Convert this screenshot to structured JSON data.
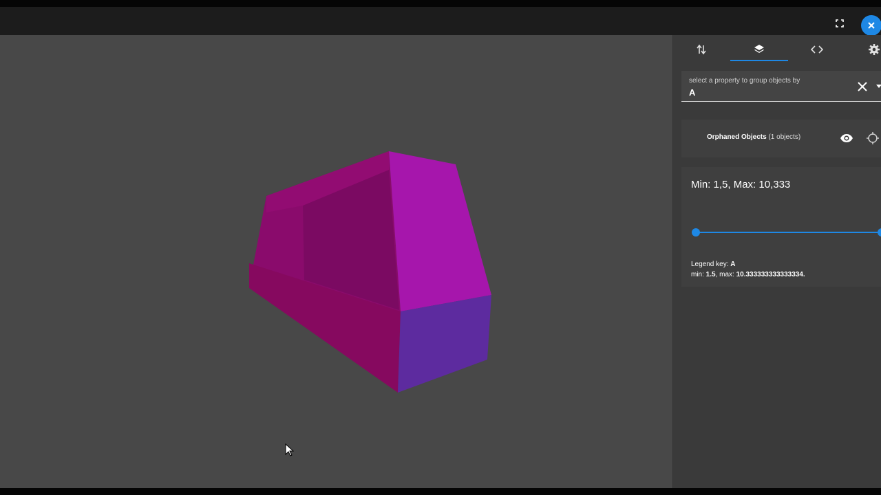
{
  "window": {
    "fullscreen_icon": "fullscreen-icon",
    "close_icon": "close-icon",
    "accent_color": "#1e88e5"
  },
  "viewport": {
    "background_color": "#484848",
    "object_colors": [
      "#a616ac",
      "#8a0b6c",
      "#5d2b9f"
    ]
  },
  "panel": {
    "tabs": [
      {
        "icon": "sort-arrows-icon",
        "active": false
      },
      {
        "icon": "layers-icon",
        "active": true
      },
      {
        "icon": "code-icon",
        "active": false
      },
      {
        "icon": "gear-icon",
        "active": false
      }
    ],
    "group_by": {
      "label": "select a property to group objects by",
      "value": "A"
    },
    "orphaned": {
      "name": "Orphaned Objects",
      "count": "(1 objects)"
    },
    "legend": {
      "min_label": "Min: ",
      "min_value": "1,5",
      "max_label": ", Max: ",
      "max_value": "10,333",
      "range_min": 1.5,
      "range_max": 10.333333333333334,
      "key_prefix": "Legend key: ",
      "key_value": "A",
      "min_text_label": "min: ",
      "min_text_value": "1.5",
      "max_text_label": ", max: ",
      "max_text_value": "10.333333333333334."
    }
  }
}
